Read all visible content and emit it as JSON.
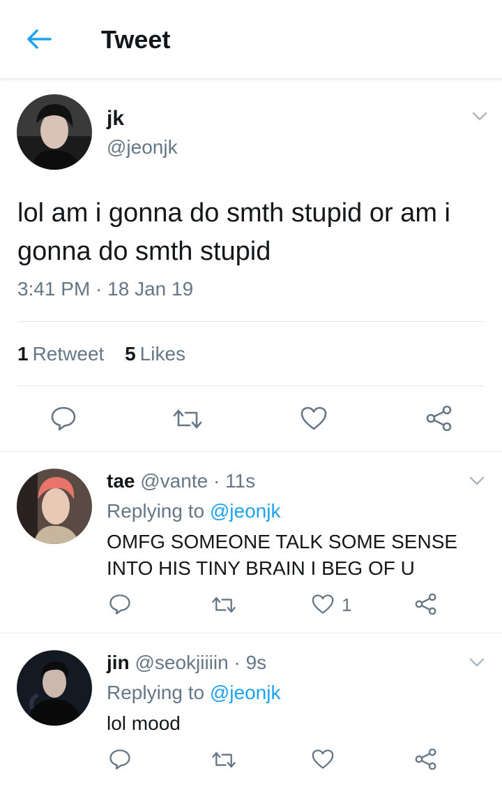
{
  "header": {
    "title": "Tweet",
    "back_icon": "arrow-left-icon",
    "accent": "#1da1f2"
  },
  "main_tweet": {
    "name": "jk",
    "handle": "@jeonjk",
    "text": "lol am i gonna do smth stupid or am i gonna do smth stupid",
    "timestamp": "3:41 PM · 18 Jan 19",
    "retweet_count": "1",
    "retweet_label": "Retweet",
    "like_count": "5",
    "like_label": "Likes"
  },
  "replies": [
    {
      "name": "tae",
      "handle": "@vante",
      "time": "11s",
      "replying_label": "Replying to",
      "replying_to": "@jeonjk",
      "text": "OMFG SOMEONE TALK SOME SENSE INTO HIS TINY BRAIN I BEG OF U",
      "like_count": "1"
    },
    {
      "name": "jin",
      "handle": "@seokjiiiin",
      "time": "9s",
      "replying_label": "Replying to",
      "replying_to": "@jeonjk",
      "text": "lol mood",
      "like_count": ""
    }
  ],
  "colors": {
    "text": "#14171a",
    "secondary": "#657786",
    "link": "#1da1f2",
    "divider": "#e1e8ed"
  }
}
